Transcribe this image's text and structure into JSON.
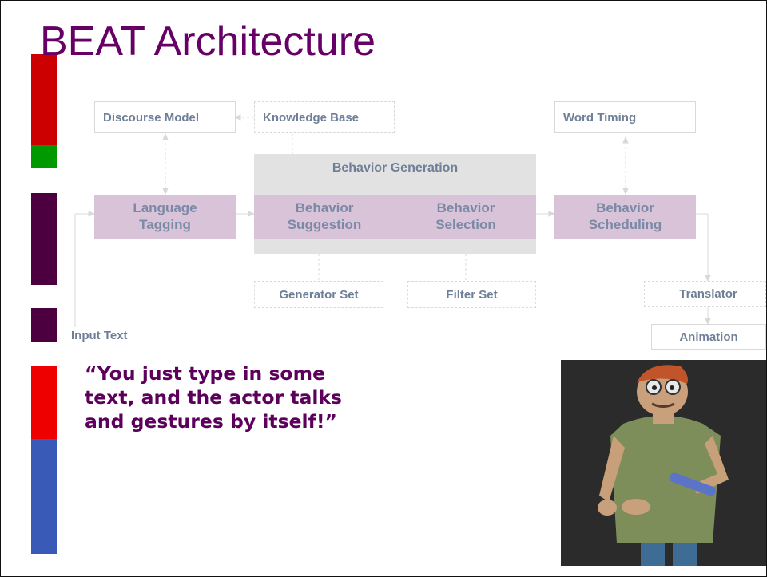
{
  "title": "BEAT Architecture",
  "side_bar_colors": [
    "#cc0000",
    "#009900",
    "#4d0040",
    "#4d0040",
    "#ee0000",
    "#3a5ab8"
  ],
  "diagram": {
    "discourse_model": "Discourse Model",
    "knowledge_base": "Knowledge Base",
    "word_timing": "Word Timing",
    "behavior_generation": "Behavior Generation",
    "language_tagging": "Language Tagging",
    "behavior_suggestion": "Behavior Suggestion",
    "behavior_selection": "Behavior Selection",
    "behavior_scheduling": "Behavior Scheduling",
    "generator_set": "Generator Set",
    "filter_set": "Filter Set",
    "translator": "Translator",
    "animation": "Animation",
    "input_text": "Input Text"
  },
  "quote": "“You just type in some text, and the actor talks and gestures by itself!”"
}
